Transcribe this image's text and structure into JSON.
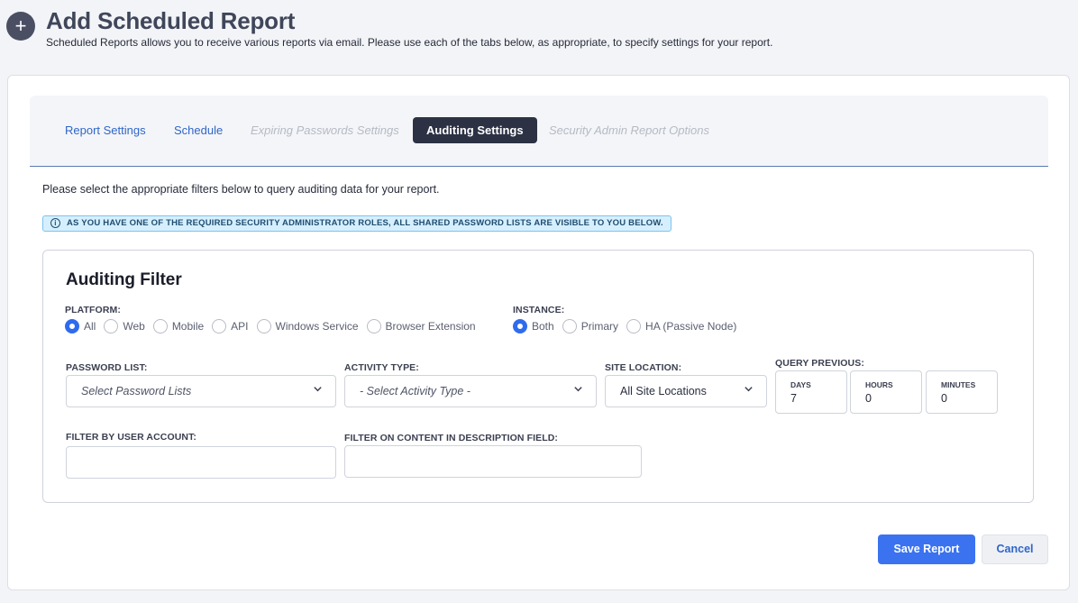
{
  "header": {
    "icon": "plus-circle-icon",
    "title": "Add Scheduled Report",
    "subtitle": "Scheduled Reports allows you to receive various reports via email. Please use each of the tabs below, as appropriate, to specify settings for your report."
  },
  "tabs": [
    {
      "label": "Report Settings",
      "state": "link"
    },
    {
      "label": "Schedule",
      "state": "link"
    },
    {
      "label": "Expiring Passwords Settings",
      "state": "disabled"
    },
    {
      "label": "Auditing Settings",
      "state": "active"
    },
    {
      "label": "Security Admin Report Options",
      "state": "disabled"
    }
  ],
  "intro_text": "Please select the appropriate filters below to query auditing data for your report.",
  "alert": {
    "icon": "info-circle-icon",
    "text": "AS YOU HAVE ONE OF THE REQUIRED SECURITY ADMINISTRATOR ROLES, ALL SHARED PASSWORD LISTS ARE VISIBLE TO YOU BELOW."
  },
  "filter": {
    "title": "Auditing Filter",
    "platform": {
      "label": "PLATFORM:",
      "options": [
        "All",
        "Web",
        "Mobile",
        "API",
        "Windows Service",
        "Browser Extension"
      ],
      "selected": "All"
    },
    "instance": {
      "label": "INSTANCE:",
      "options": [
        "Both",
        "Primary",
        "HA (Passive Node)"
      ],
      "selected": "Both"
    },
    "password_list": {
      "label": "PASSWORD LIST:",
      "placeholder": "Select Password Lists"
    },
    "activity_type": {
      "label": "ACTIVITY TYPE:",
      "placeholder": "- Select Activity Type -"
    },
    "site_location": {
      "label": "SITE LOCATION:",
      "value": "All Site Locations"
    },
    "query_previous": {
      "label": "QUERY PREVIOUS:",
      "days_label": "DAYS",
      "days": "7",
      "hours_label": "HOURS",
      "hours": "0",
      "minutes_label": "MINUTES",
      "minutes": "0"
    },
    "user_account": {
      "label": "FILTER BY USER ACCOUNT:",
      "value": ""
    },
    "description": {
      "label": "FILTER ON CONTENT IN DESCRIPTION FIELD:",
      "value": ""
    }
  },
  "buttons": {
    "save": "Save Report",
    "cancel": "Cancel"
  },
  "colors": {
    "accent": "#3a72f0",
    "active_tab": "#2c3244",
    "alert_bg": "#d6efff"
  }
}
